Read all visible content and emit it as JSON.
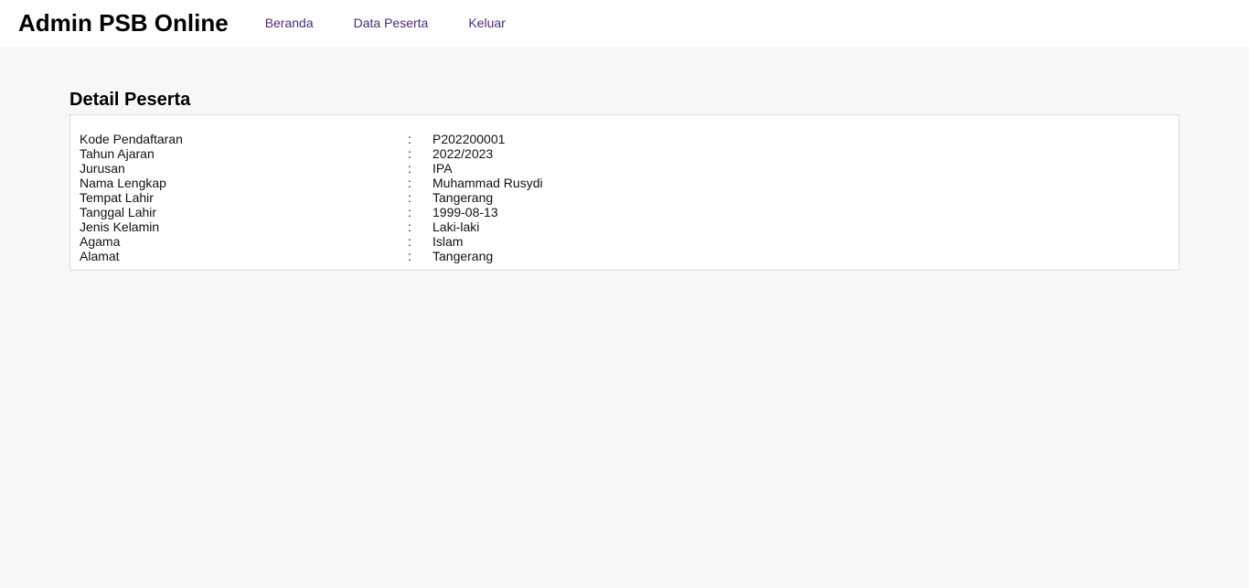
{
  "header": {
    "brand": "Admin PSB Online",
    "nav": [
      {
        "label": "Beranda"
      },
      {
        "label": "Data Peserta"
      },
      {
        "label": "Keluar"
      }
    ]
  },
  "page": {
    "title": "Detail Peserta",
    "separator": ":",
    "fields": [
      {
        "label": "Kode Pendaftaran",
        "value": "P202200001"
      },
      {
        "label": "Tahun Ajaran",
        "value": "2022/2023"
      },
      {
        "label": "Jurusan",
        "value": "IPA"
      },
      {
        "label": "Nama Lengkap",
        "value": "Muhammad Rusydi"
      },
      {
        "label": "Tempat Lahir",
        "value": "Tangerang"
      },
      {
        "label": "Tanggal Lahir",
        "value": "1999-08-13"
      },
      {
        "label": "Jenis Kelamin",
        "value": "Laki-laki"
      },
      {
        "label": "Agama",
        "value": "Islam"
      },
      {
        "label": "Alamat",
        "value": "Tangerang"
      }
    ]
  }
}
